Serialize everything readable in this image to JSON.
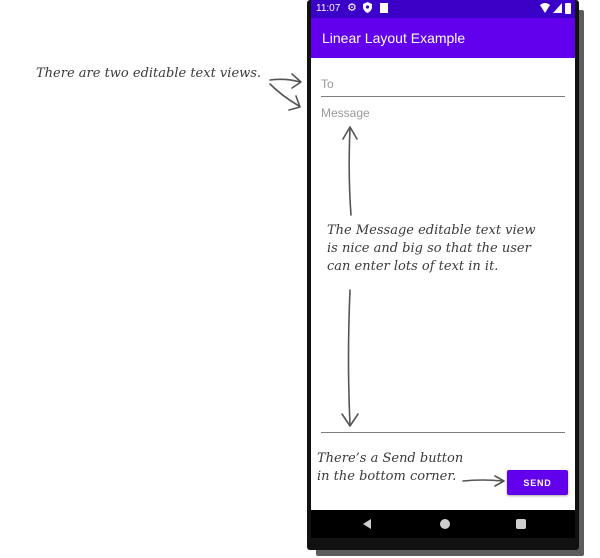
{
  "status_bar": {
    "time": "11:07",
    "icons": [
      "gear-icon",
      "shield-icon",
      "sd-card-icon",
      "wifi-icon",
      "signal-icon",
      "battery-icon"
    ]
  },
  "app_bar": {
    "title": "Linear Layout Example"
  },
  "form": {
    "to_placeholder": "To",
    "message_placeholder": "Message",
    "send_label": "SEND"
  },
  "nav_bar": {
    "icons": [
      "back-icon",
      "home-icon",
      "recents-icon"
    ]
  },
  "annotations": {
    "two_fields": "There are two editable text views.",
    "message_note": [
      "The Message editable text view",
      "is nice and big so that the user",
      "can enter lots of text in it."
    ],
    "send_note": [
      "There’s a Send button",
      "in the bottom corner."
    ]
  },
  "colors": {
    "status_bar": "#3b00c8",
    "primary": "#6200ee",
    "nav_bar": "#000000"
  }
}
